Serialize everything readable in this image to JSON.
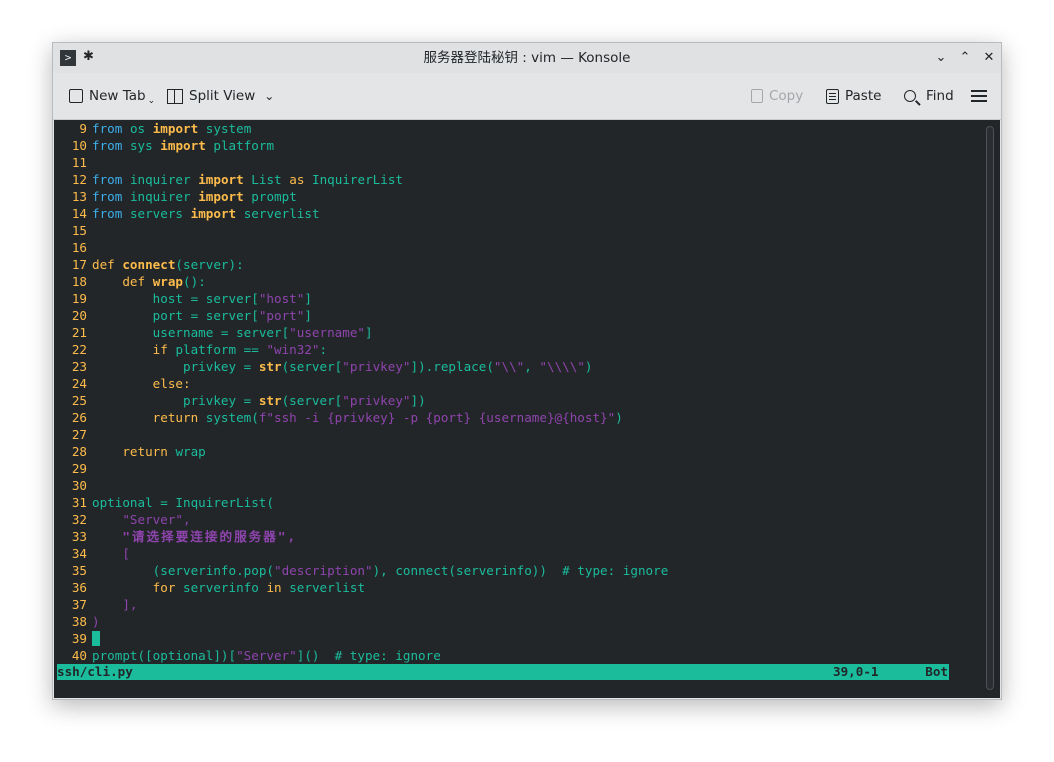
{
  "window": {
    "title": "服务器登陆秘钥 : vim — Konsole",
    "controls": [
      "minimize",
      "maximize",
      "close"
    ]
  },
  "toolbar": {
    "new_tab": "New Tab",
    "split_view": "Split View",
    "copy": "Copy",
    "paste": "Paste",
    "find": "Find"
  },
  "editor": {
    "lines": [
      {
        "n": "9"
      },
      {
        "n": "10"
      },
      {
        "n": "11"
      },
      {
        "n": "12"
      },
      {
        "n": "13"
      },
      {
        "n": "14"
      },
      {
        "n": "15"
      },
      {
        "n": "16"
      },
      {
        "n": "17"
      },
      {
        "n": "18"
      },
      {
        "n": "19"
      },
      {
        "n": "20"
      },
      {
        "n": "21"
      },
      {
        "n": "22"
      },
      {
        "n": "23"
      },
      {
        "n": "24"
      },
      {
        "n": "25"
      },
      {
        "n": "26"
      },
      {
        "n": "27"
      },
      {
        "n": "28"
      },
      {
        "n": "29"
      },
      {
        "n": "30"
      },
      {
        "n": "31"
      },
      {
        "n": "32"
      },
      {
        "n": "33"
      },
      {
        "n": "34"
      },
      {
        "n": "35"
      },
      {
        "n": "36"
      },
      {
        "n": "37"
      },
      {
        "n": "38"
      },
      {
        "n": "39"
      },
      {
        "n": "40"
      }
    ],
    "tokens": {
      "from": "from",
      "import": "import",
      "as": "as",
      "def": "def",
      "return": "return",
      "if": "if",
      "else": "else:",
      "for": "for",
      "in": "in",
      "os": "os",
      "system": "system",
      "sys": "sys",
      "platform": "platform",
      "inquirer": "inquirer",
      "List": "List",
      "InquirerList": "InquirerList",
      "prompt": "prompt",
      "servers": "servers",
      "serverlist": "serverlist",
      "connect": "connect",
      "server_arg": "(server):",
      "wrap": "wrap",
      "wrap_args": "():",
      "host_assign": "host = server[",
      "host_key": "\"host\"",
      "close_bracket": "]",
      "port_assign": "port = server[",
      "port_key": "\"port\"",
      "user_assign": "username = server[",
      "user_key": "\"username\"",
      "if_cond": "platform == ",
      "win32": "\"win32\"",
      "colon": ":",
      "privkey_assign": "privkey = ",
      "str": "str",
      "server_open": "(server[",
      "privkey_key": "\"privkey\"",
      "replace_call": "]).replace(",
      "bs2": "\"\\\\\"",
      "comma": ", ",
      "bs4": "\"\\\\\\\\\"",
      "close_paren": ")",
      "privkey_close": "])",
      "system_call": "system(",
      "fstring": "f\"ssh -i {privkey} -p {port} {username}@{host}\"",
      "return_wrap": "wrap",
      "optional_assign": "optional = InquirerList(",
      "server_str": "\"Server\",",
      "zh_str": "\"请选择要连接的服务器\",",
      "open_list": "[",
      "tuple_line": "(serverinfo.pop(",
      "desc_key": "\"description\"",
      "tuple_rest": "), connect(serverinfo))  # type: ignore",
      "for_var": "serverinfo",
      "close_list": "],",
      "paren_close": ")",
      "prompt_call": "prompt([optional])[",
      "server_key": "\"Server\"",
      "prompt_rest": "]()  # type: ignore"
    }
  },
  "statusline": {
    "file": "ssh/cli.py",
    "position": "39,0-1",
    "scroll": "Bot"
  },
  "colors": {
    "background": "#232629",
    "keyword": "#fdbc4b",
    "module": "#3daee9",
    "identifier": "#1abc9c",
    "string": "#8e44ad"
  }
}
